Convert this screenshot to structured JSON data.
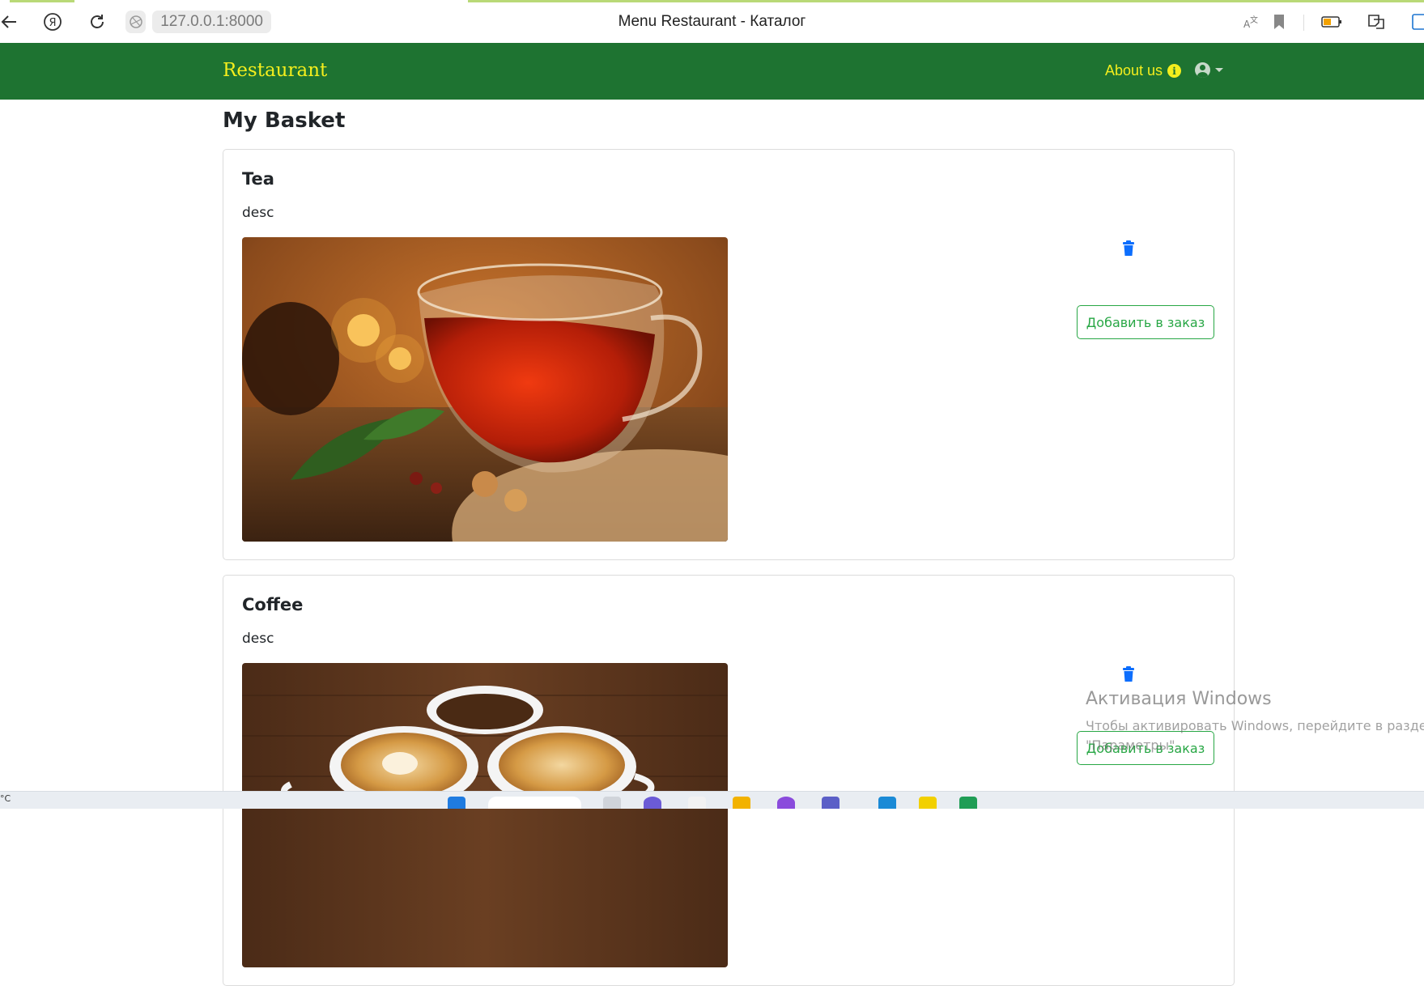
{
  "browser": {
    "url": "127.0.0.1:8000",
    "tab_title": "Menu Restaurant - Каталог"
  },
  "navbar": {
    "brand": "Restaurant",
    "about_label": "About us",
    "bg_color": "#1e7331",
    "accent_color": "#f4ee1d"
  },
  "page": {
    "title": "My Basket"
  },
  "basket": {
    "items": [
      {
        "title": "Tea",
        "desc": "desc",
        "image_alt": "Tea",
        "add_button": "Добавить в заказ"
      },
      {
        "title": "Coffee",
        "desc": "desc",
        "image_alt": "Coffee",
        "add_button": "Добавить в заказ"
      }
    ]
  },
  "watermark": {
    "title": "Активация Windows",
    "subtitle": "Чтобы активировать Windows, перейдите в раздел",
    "subtitle2": "\"Параметры\"."
  },
  "taskbar": {
    "temp_unit": "°C"
  }
}
